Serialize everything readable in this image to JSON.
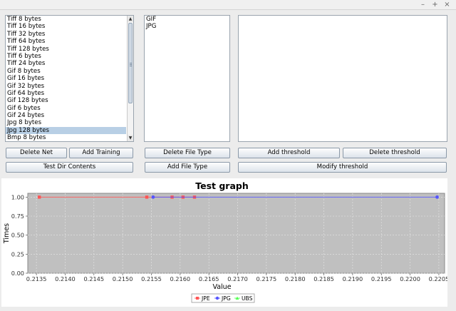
{
  "window": {
    "controls": [
      "–",
      "+",
      "×"
    ]
  },
  "net_list": {
    "items": [
      "Tiff 8 bytes",
      "Tiff 16 bytes",
      "Tiff 32 bytes",
      "Tiff 64 bytes",
      "Tiff 128 bytes",
      "Tiff 6 bytes",
      "Tiff 24 bytes",
      "Gif 8 bytes",
      "Gif 16 bytes",
      "Gif 32 bytes",
      "Gif 64 bytes",
      "Gif 128 bytes",
      "Gif 6 bytes",
      "Gif 24 bytes",
      "Jpg 8 bytes",
      "Jpg 128 bytes",
      "Bmp 8 bytes"
    ],
    "selected_index": 15,
    "scroll_up": "▲",
    "scroll_down": "▼"
  },
  "file_type_list": {
    "items": [
      "GIF",
      "JPG"
    ]
  },
  "buttons": {
    "delete_net": "Delete Net",
    "add_training": "Add Training",
    "test_dir_contents": "Test Dir Contents",
    "delete_file_type": "Delete File Type",
    "add_file_type": "Add File Type",
    "add_threshold": "Add threshold",
    "delete_threshold": "Delete threshold",
    "modify_threshold": "Modify threshold"
  },
  "colors": {
    "plot_bg": "#c0c0c0",
    "grid": "#e6e6e6",
    "jpe": "#ff5555",
    "jpg": "#5555ff",
    "ubs": "#55ff55"
  },
  "chart_data": {
    "type": "line",
    "title": "Test graph",
    "xlabel": "Value",
    "ylabel": "Times",
    "xlim": [
      0.21335,
      0.2206
    ],
    "ylim": [
      0.0,
      1.05
    ],
    "x_ticks": [
      "0.2135",
      "0.2140",
      "0.2145",
      "0.2150",
      "0.2155",
      "0.2160",
      "0.2165",
      "0.2170",
      "0.2175",
      "0.2180",
      "0.2185",
      "0.2190",
      "0.2195",
      "0.2200",
      "0.2205"
    ],
    "y_ticks": [
      "0.00",
      "0.25",
      "0.50",
      "0.75",
      "1.00"
    ],
    "legend_position": "bottom-center",
    "series": [
      {
        "name": "JPE",
        "color": "#ff5555",
        "marker": "square",
        "x": [
          0.21355,
          0.21542,
          0.21586,
          0.21605,
          0.21625
        ],
        "y": [
          1,
          1,
          1,
          1,
          1
        ]
      },
      {
        "name": "JPG",
        "color": "#5555ff",
        "marker": "circle",
        "x": [
          0.21553,
          0.22047
        ],
        "y": [
          1,
          1
        ]
      },
      {
        "name": "UBS",
        "color": "#55ff55",
        "marker": "triangle",
        "x": [],
        "y": []
      }
    ]
  }
}
